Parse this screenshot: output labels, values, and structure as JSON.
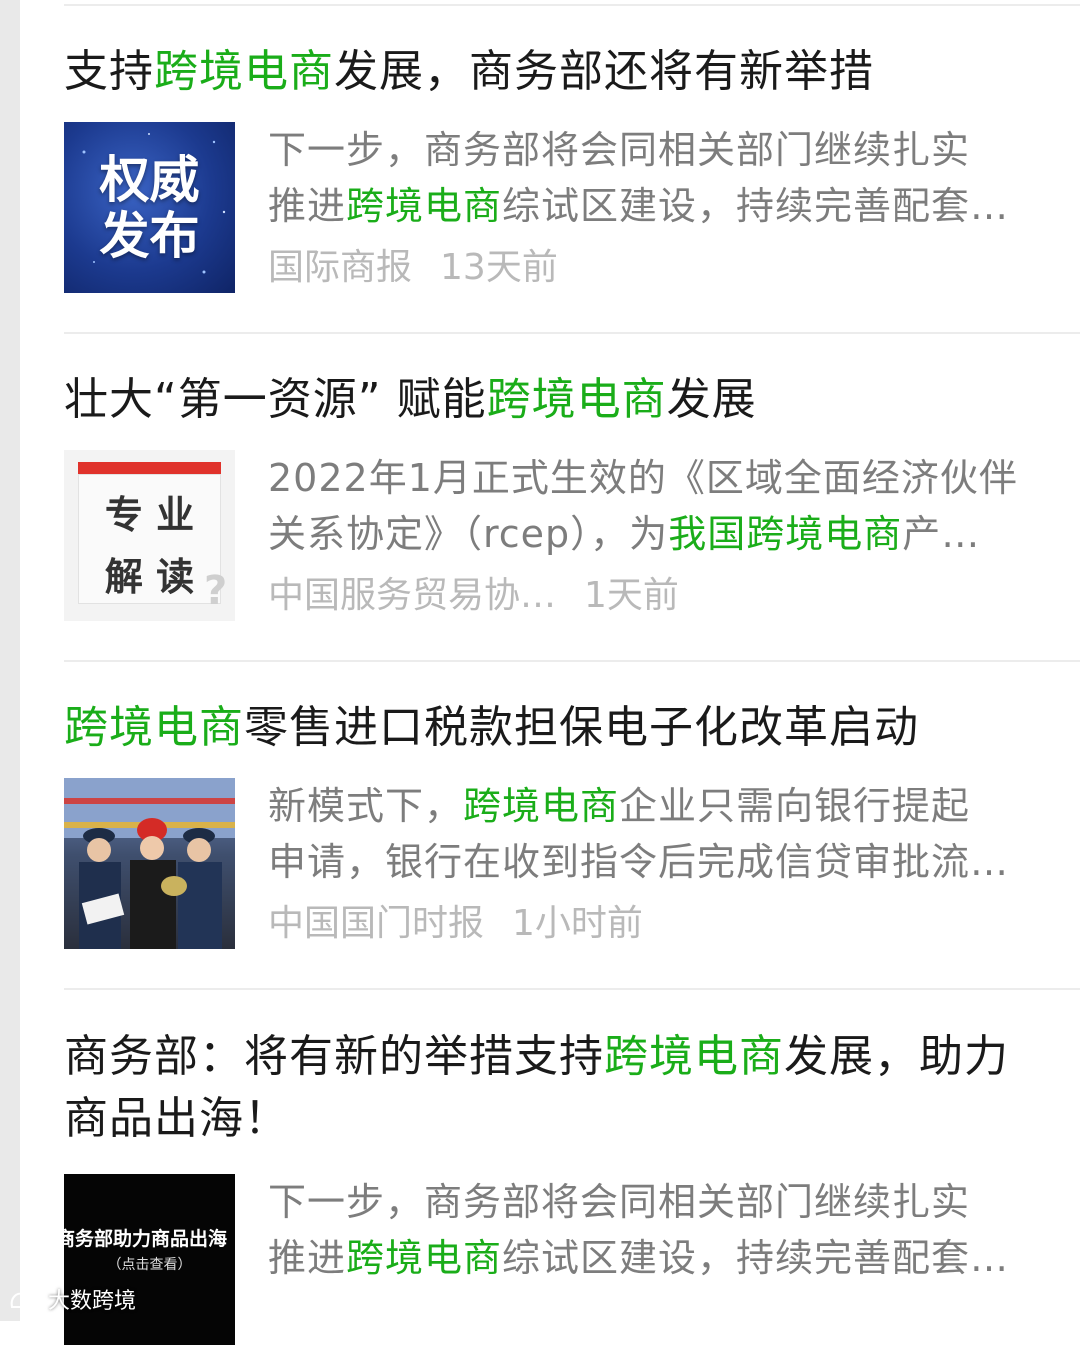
{
  "watermark": {
    "label": "大数跨境"
  },
  "items": [
    {
      "title": [
        {
          "t": "支持"
        },
        {
          "t": "跨境电商",
          "hl": true
        },
        {
          "t": "发展，商务部还将有新举措"
        }
      ],
      "summary_line1": [
        {
          "t": "下一步，商务部将会同相关部门继续扎实"
        }
      ],
      "summary_line2": [
        {
          "t": "推进"
        },
        {
          "t": "跨境电商",
          "hl": true
        },
        {
          "t": "综试区建设，持续完善配套…"
        }
      ],
      "source": "国际商报",
      "time": "13天前",
      "thumb": {
        "text1": "权威",
        "text2": "发布"
      }
    },
    {
      "title": [
        {
          "t": "壮大“第一资源” 赋能"
        },
        {
          "t": "跨境电商",
          "hl": true
        },
        {
          "t": "发展"
        }
      ],
      "summary_line1": [
        {
          "t": "2022年1月正式生效的《区域全面经济伙伴"
        }
      ],
      "summary_line2": [
        {
          "t": "关系协定》（rcep），为"
        },
        {
          "t": "我国跨境电商",
          "hl": true
        },
        {
          "t": "产…"
        }
      ],
      "source": "中国服务贸易协…",
      "time": "1天前",
      "thumb": {
        "text1": "专 业",
        "text2": "解 读"
      }
    },
    {
      "title": [
        {
          "t": "跨境电商",
          "hl": true
        },
        {
          "t": "零售进口税款担保电子化改革启动"
        }
      ],
      "summary_line1": [
        {
          "t": "新模式下，"
        },
        {
          "t": "跨境电商",
          "hl": true
        },
        {
          "t": "企业只需向银行提起"
        }
      ],
      "summary_line2": [
        {
          "t": "申请，银行在收到指令后完成信贷审批流…"
        }
      ],
      "source": "中国国门时报",
      "time": "1小时前",
      "thumb": {}
    },
    {
      "title_line1": [
        {
          "t": "商务部：将有新的举措支持"
        },
        {
          "t": "跨境电商",
          "hl": true
        },
        {
          "t": "发展，助力"
        }
      ],
      "title_line2": [
        {
          "t": "商品出海！"
        }
      ],
      "summary_line1": [
        {
          "t": "下一步，商务部将会同相关部门继续扎实"
        }
      ],
      "summary_line2": [
        {
          "t": "推进"
        },
        {
          "t": "跨境电商",
          "hl": true
        },
        {
          "t": "综试区建设，持续完善配套…"
        }
      ],
      "thumb": {
        "text1": "商务部助力商品出海",
        "text2": "（点击查看）"
      }
    }
  ],
  "colors": {
    "highlight": "#1aad19",
    "title": "#1a1a1a",
    "summary": "#7d7d7d",
    "meta": "#b9b9b9"
  }
}
